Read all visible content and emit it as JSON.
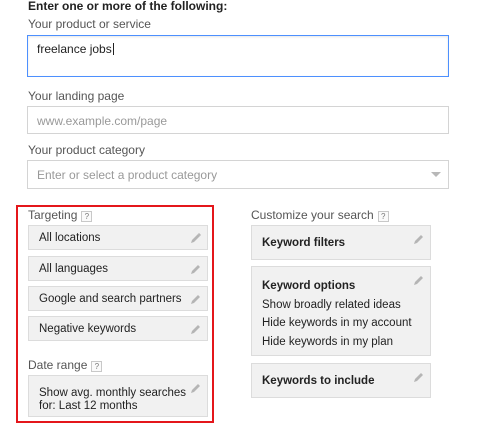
{
  "form": {
    "heading": "Enter one or more of the following:",
    "product_label": "Your product or service",
    "product_value": "freelance jobs",
    "landing_label": "Your landing page",
    "landing_placeholder": "www.example.com/page",
    "category_label": "Your product category",
    "category_placeholder": "Enter or select a product category"
  },
  "targeting": {
    "label": "Targeting",
    "help": "?",
    "items": [
      {
        "label": "All locations"
      },
      {
        "label": "All languages"
      },
      {
        "label": "Google and search partners"
      },
      {
        "label": "Negative keywords"
      }
    ],
    "date_range_label": "Date range",
    "date_range_help": "?",
    "date_range_value_line1": "Show avg. monthly searches",
    "date_range_value_line2": "for: Last 12 months"
  },
  "customize": {
    "label": "Customize your search",
    "help": "?",
    "keyword_filters": "Keyword filters",
    "keyword_options_title": "Keyword options",
    "keyword_options_lines": [
      "Show broadly related ideas",
      "Hide keywords in my account",
      "Hide keywords in my plan"
    ],
    "keywords_to_include": "Keywords to include"
  },
  "colors": {
    "highlight": "#e4161b",
    "focus_border": "#4d90fe"
  },
  "icons": {
    "edit": "pencil-icon",
    "dropdown": "triangle-down-icon",
    "help": "question-mark-icon"
  }
}
